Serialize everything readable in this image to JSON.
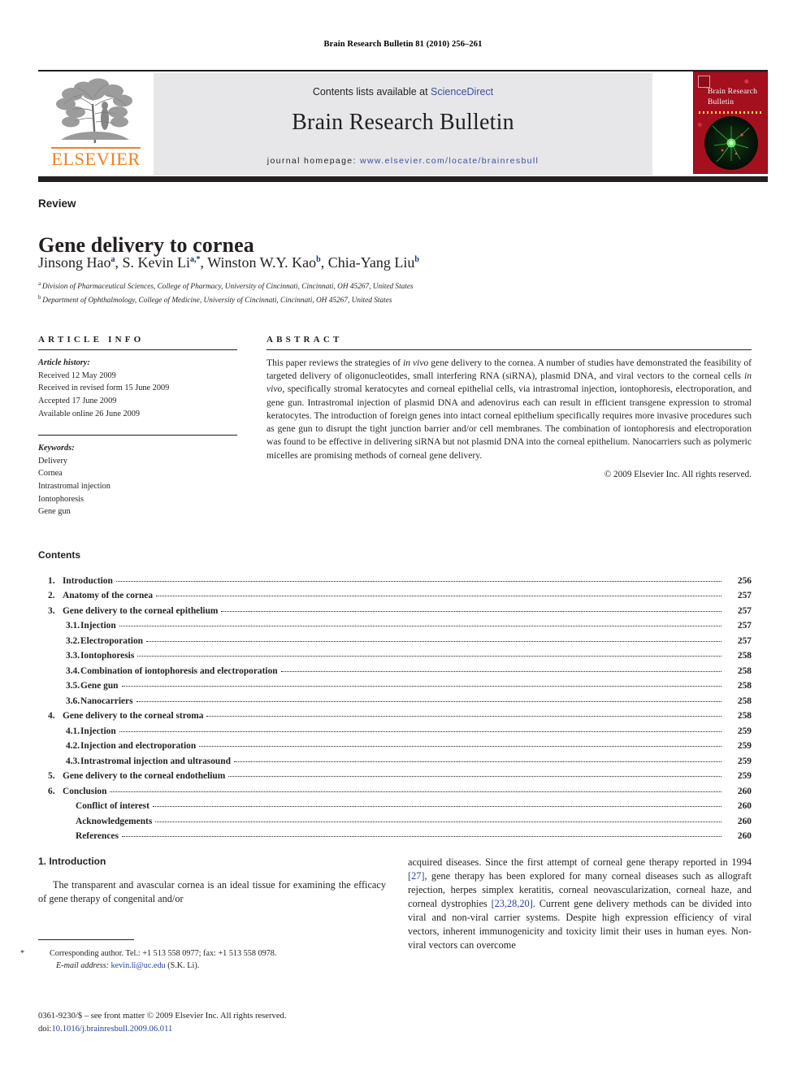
{
  "running_head": "Brain Research Bulletin 81 (2010) 256–261",
  "masthead": {
    "contents_available_prefix": "Contents lists available at ",
    "sciencedirect": "ScienceDirect",
    "journal_name": "Brain Research Bulletin",
    "homepage_label": "journal homepage:",
    "homepage_url": "www.elsevier.com/locate/brainresbull",
    "publisher_wordmark": "ELSEVIER",
    "cover_title": "Brain Research Bulletin",
    "colors": {
      "elsevier_orange": "#f08222",
      "link_blue": "#3b4ea0",
      "rule_dark": "#231f20",
      "panel_grey": "#e7e7e9",
      "cover_red": "#a5101f"
    }
  },
  "article": {
    "type": "Review",
    "title": "Gene delivery to cornea",
    "authors": [
      {
        "name": "Jinsong Hao",
        "marks": "a"
      },
      {
        "name": "S. Kevin Li",
        "marks": "a,*"
      },
      {
        "name": "Winston W.Y. Kao",
        "marks": "b"
      },
      {
        "name": "Chia-Yang Liu",
        "marks": "b"
      }
    ],
    "affiliations": [
      {
        "mark": "a",
        "text": "Division of Pharmaceutical Sciences, College of Pharmacy, University of Cincinnati, Cincinnati, OH 45267, United States"
      },
      {
        "mark": "b",
        "text": "Department of Ophthalmology, College of Medicine, University of Cincinnati, Cincinnati, OH 45267, United States"
      }
    ]
  },
  "article_info": {
    "heading": "ARTICLE INFO",
    "history_label": "Article history:",
    "history": [
      "Received 12 May 2009",
      "Received in revised form 15 June 2009",
      "Accepted 17 June 2009",
      "Available online 26 June 2009"
    ],
    "keywords_label": "Keywords:",
    "keywords": [
      "Delivery",
      "Cornea",
      "Intrastromal injection",
      "Iontophoresis",
      "Gene gun"
    ]
  },
  "abstract": {
    "heading": "ABSTRACT",
    "paragraph_1": "This paper reviews the strategies of ",
    "italic_1": "in vivo",
    "paragraph_2": " gene delivery to the cornea. A number of studies have demonstrated the feasibility of targeted delivery of oligonucleotides, small interfering RNA (siRNA), plasmid DNA, and viral vectors to the corneal cells ",
    "italic_2": "in vivo",
    "paragraph_3": ", specifically stromal keratocytes and corneal epithelial cells, via intrastromal injection, iontophoresis, electroporation, and gene gun. Intrastromal injection of plasmid DNA and adenovirus each can result in efficient transgene expression to stromal keratocytes. The introduction of foreign genes into intact corneal epithelium specifically requires more invasive procedures such as gene gun to disrupt the tight junction barrier and/or cell membranes. The combination of iontophoresis and electroporation was found to be effective in delivering siRNA but not plasmid DNA into the corneal epithelium. Nanocarriers such as polymeric micelles are promising methods of corneal gene delivery.",
    "copyright": "© 2009 Elsevier Inc. All rights reserved."
  },
  "contents": {
    "heading": "Contents",
    "entries": [
      {
        "num": "1.",
        "label": "Introduction",
        "page": "256",
        "level": 1
      },
      {
        "num": "2.",
        "label": "Anatomy of the cornea",
        "page": "257",
        "level": 1
      },
      {
        "num": "3.",
        "label": "Gene delivery to the corneal epithelium",
        "page": "257",
        "level": 1
      },
      {
        "num": "3.1.",
        "label": "Injection",
        "page": "257",
        "level": 2
      },
      {
        "num": "3.2.",
        "label": "Electroporation",
        "page": "257",
        "level": 2
      },
      {
        "num": "3.3.",
        "label": "Iontophoresis",
        "page": "258",
        "level": 2
      },
      {
        "num": "3.4.",
        "label": "Combination of iontophoresis and electroporation",
        "page": "258",
        "level": 2
      },
      {
        "num": "3.5.",
        "label": "Gene gun",
        "page": "258",
        "level": 2
      },
      {
        "num": "3.6.",
        "label": "Nanocarriers",
        "page": "258",
        "level": 2
      },
      {
        "num": "4.",
        "label": "Gene delivery to the corneal stroma",
        "page": "258",
        "level": 1
      },
      {
        "num": "4.1.",
        "label": "Injection",
        "page": "259",
        "level": 2
      },
      {
        "num": "4.2.",
        "label": "Injection and electroporation",
        "page": "259",
        "level": 2
      },
      {
        "num": "4.3.",
        "label": "Intrastromal injection and ultrasound",
        "page": "259",
        "level": 2
      },
      {
        "num": "5.",
        "label": "Gene delivery to the corneal endothelium",
        "page": "259",
        "level": 1
      },
      {
        "num": "6.",
        "label": "Conclusion",
        "page": "260",
        "level": 1
      },
      {
        "num": "",
        "label": "Conflict of interest",
        "page": "260",
        "level": 3
      },
      {
        "num": "",
        "label": "Acknowledgements",
        "page": "260",
        "level": 3
      },
      {
        "num": "",
        "label": "References",
        "page": "260",
        "level": 3
      }
    ]
  },
  "introduction": {
    "heading": "1. Introduction",
    "left_text": "The transparent and avascular cornea is an ideal tissue for examining the efficacy of gene therapy of congenital and/or",
    "right_part_1": "acquired diseases. Since the first attempt of corneal gene therapy reported in 1994 ",
    "cite_1": "[27]",
    "right_part_2": ", gene therapy has been explored for many corneal diseases such as allograft rejection, herpes simplex keratitis, corneal neovascularization, corneal haze, and corneal dystrophies ",
    "cite_2": "[23,28,20]",
    "right_part_3": ". Current gene delivery methods can be divided into viral and non-viral carrier systems. Despite high expression efficiency of viral vectors, inherent immunogenicity and toxicity limit their uses in human eyes. Non-viral vectors can overcome"
  },
  "footnote": {
    "corresponding": "Corresponding author. Tel.: +1 513 558 0977; fax: +1 513 558 0978.",
    "email_label": "E-mail address:",
    "email": "kevin.li@uc.edu",
    "email_suffix": " (S.K. Li).",
    "imprint": "0361-9230/$ – see front matter © 2009 Elsevier Inc. All rights reserved.",
    "doi_label": "doi:",
    "doi": "10.1016/j.brainresbull.2009.06.011"
  }
}
